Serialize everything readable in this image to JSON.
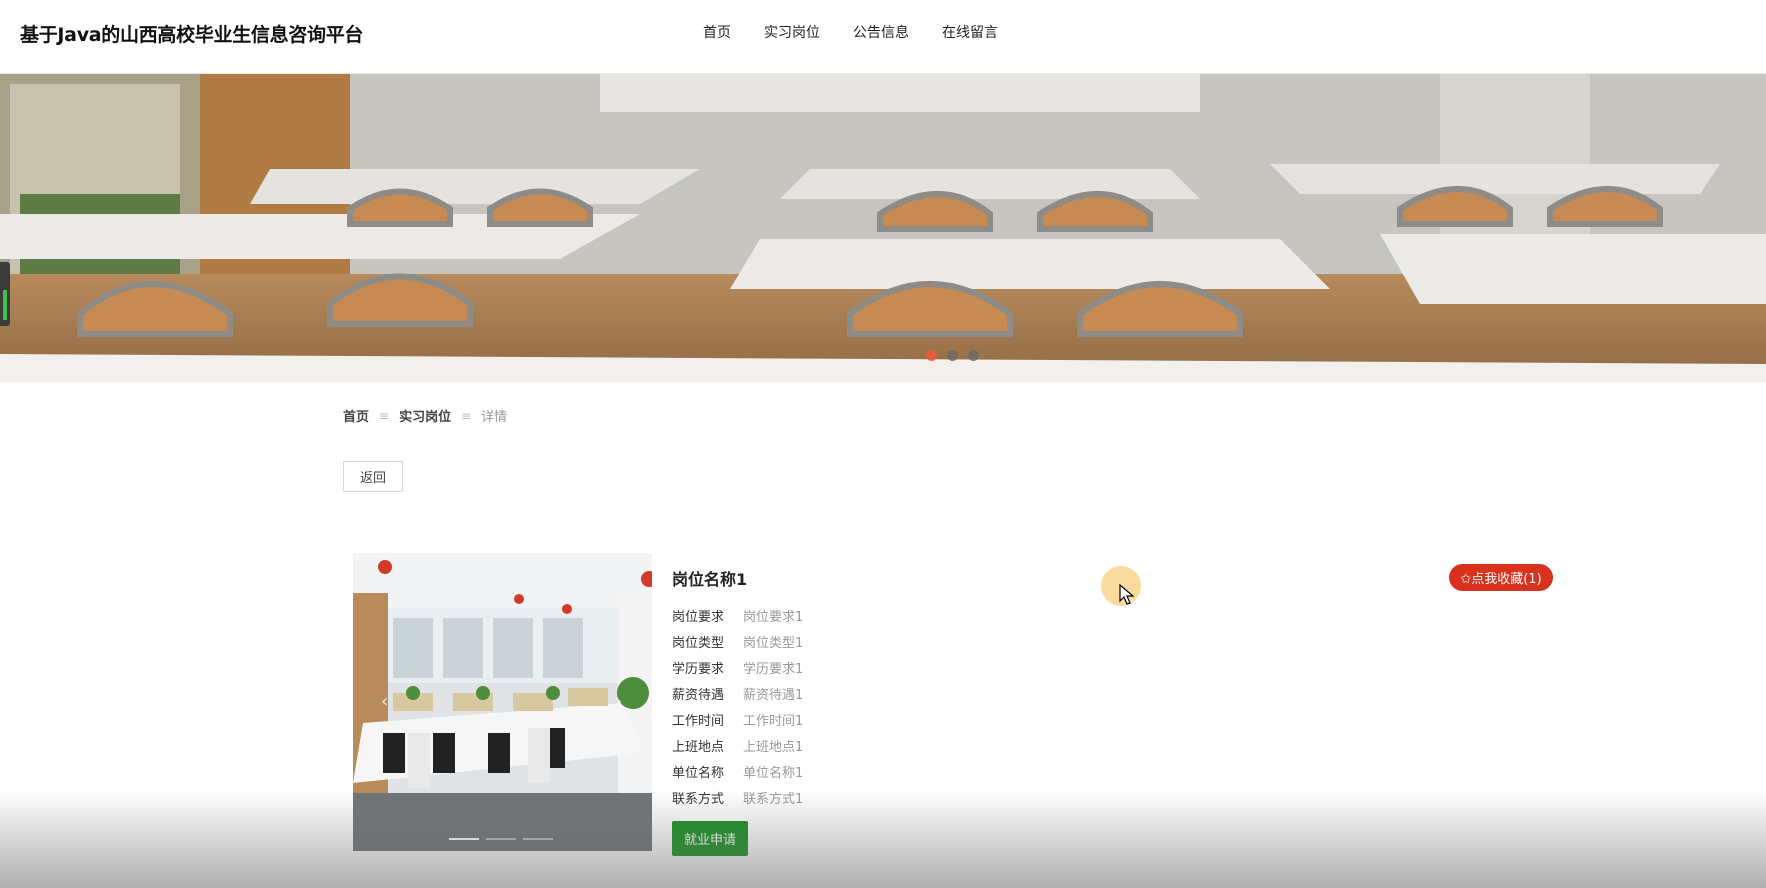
{
  "header": {
    "site_title": "基于Java的山西高校毕业生信息咨询平台",
    "nav": [
      {
        "label": "首页"
      },
      {
        "label": "实习岗位"
      },
      {
        "label": "公告信息"
      },
      {
        "label": "在线留言"
      }
    ]
  },
  "banner": {
    "slide_count": 3,
    "active_slide": 1
  },
  "breadcrumb": {
    "items": [
      "首页",
      "实习岗位"
    ],
    "current": "详情",
    "separator": "≡"
  },
  "back_button": "返回",
  "job": {
    "title": "岗位名称1",
    "fields": [
      {
        "label": "岗位要求",
        "value": "岗位要求1"
      },
      {
        "label": "岗位类型",
        "value": "岗位类型1"
      },
      {
        "label": "学历要求",
        "value": "学历要求1"
      },
      {
        "label": "薪资待遇",
        "value": "薪资待遇1"
      },
      {
        "label": "工作时间",
        "value": "工作时间1"
      },
      {
        "label": "上班地点",
        "value": "上班地点1"
      },
      {
        "label": "单位名称",
        "value": "单位名称1"
      },
      {
        "label": "联系方式",
        "value": "联系方式1"
      }
    ],
    "apply_button": "就业申请",
    "favorite_button": "✩点我收藏(1)"
  },
  "gallery": {
    "prev": "‹",
    "next": "›",
    "slide_count": 3,
    "active_slide": 1
  },
  "colors": {
    "accent_red": "#d8321f",
    "apply_green": "#17911f",
    "banner_active_dot": "#ef5a3c"
  }
}
